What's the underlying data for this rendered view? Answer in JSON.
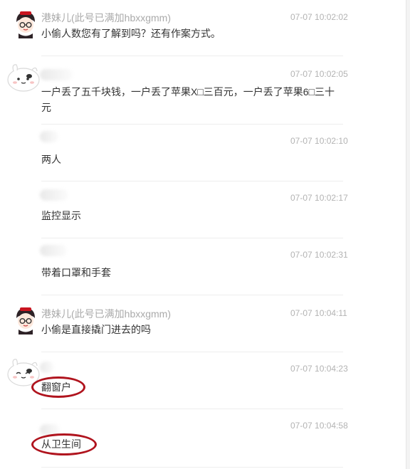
{
  "messages": [
    {
      "sender": "港妹儿(此号已满加hbxxgmm)",
      "time": "07-07 10:02:02",
      "text": "小偷人数您有了解到吗？还有作案方式。"
    },
    {
      "sender": "",
      "time": "07-07 10:02:05",
      "text": "一户丢了五千块钱，一户丢了苹果X□三百元，一户丢了苹果6□三十元"
    },
    {
      "sender": "",
      "time": "07-07 10:02:10",
      "text": "两人"
    },
    {
      "sender": "",
      "time": "07-07 10:02:17",
      "text": "监控显示"
    },
    {
      "sender": "",
      "time": "07-07 10:02:31",
      "text": "带着口罩和手套"
    },
    {
      "sender": "港妹儿(此号已满加hbxxgmm)",
      "time": "07-07 10:04:11",
      "text": "小偷是直接撬门进去的吗"
    },
    {
      "sender": "",
      "time": "07-07 10:04:23",
      "text": "翻窗户"
    },
    {
      "sender": "",
      "time": "07-07 10:04:58",
      "text": "从卫生间"
    }
  ],
  "highlight_color": "#b0141e"
}
